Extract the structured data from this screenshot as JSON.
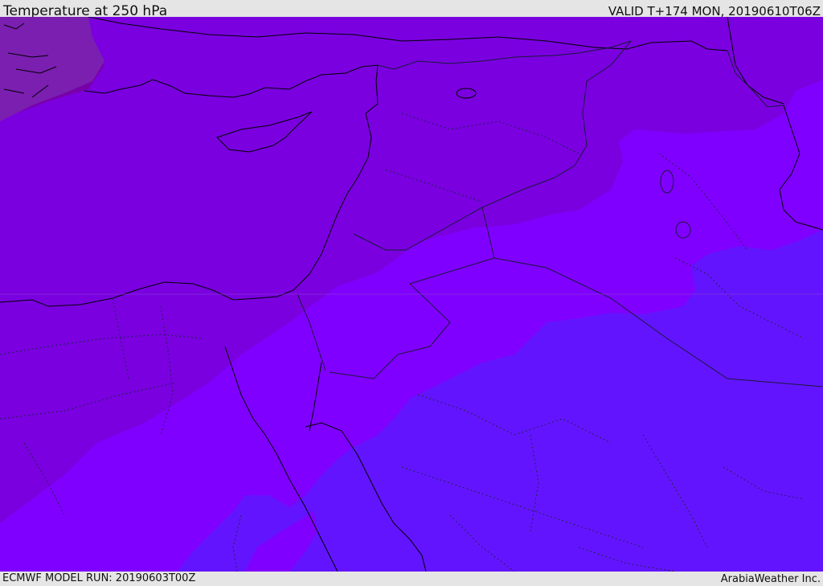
{
  "header": {
    "title": "Temperature at 250 hPa",
    "valid_time": "VALID T+174 MON, 20190610T06Z"
  },
  "footer": {
    "model_run": "ECMWF MODEL RUN: 20190603T00Z",
    "credit": "ArabiaWeather Inc."
  },
  "map": {
    "temperature_bands": [
      {
        "name": "warmest-band",
        "color": "#7700a8"
      },
      {
        "name": "mid-band",
        "color": "#7a00e0"
      },
      {
        "name": "upper-band",
        "color": "#8000ff"
      },
      {
        "name": "coolest-band",
        "color": "#6314ff"
      }
    ],
    "coastline_color": "#000000",
    "border_color": "#1a1a3a"
  }
}
